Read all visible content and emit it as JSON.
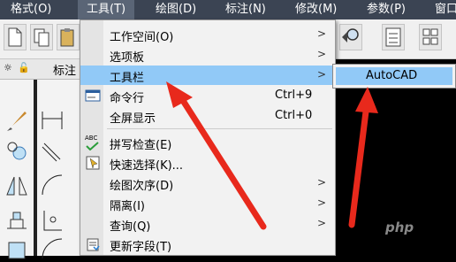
{
  "menubar": {
    "items": [
      "格式(O)",
      "工具(T)",
      "绘图(D)",
      "标注(N)",
      "修改(M)",
      "参数(P)",
      "窗口"
    ]
  },
  "row2": {
    "label": "标注"
  },
  "tools_menu": {
    "items": [
      {
        "label": "工作空间(O)",
        "shortcut": "",
        "submenu": true,
        "icon": ""
      },
      {
        "label": "选项板",
        "shortcut": "",
        "submenu": true,
        "icon": ""
      },
      {
        "label": "工具栏",
        "shortcut": "",
        "submenu": true,
        "icon": "",
        "highlighted": true
      },
      {
        "label": "命令行",
        "shortcut": "Ctrl+9",
        "submenu": false,
        "icon": "command-line-icon"
      },
      {
        "label": "全屏显示",
        "shortcut": "Ctrl+0",
        "submenu": false,
        "icon": ""
      },
      {
        "label": "拼写检查(E)",
        "shortcut": "",
        "submenu": false,
        "icon": "spell-check-icon"
      },
      {
        "label": "快速选择(K)...",
        "shortcut": "",
        "submenu": false,
        "icon": "quick-select-icon"
      },
      {
        "label": "绘图次序(D)",
        "shortcut": "",
        "submenu": true,
        "icon": ""
      },
      {
        "label": "隔离(I)",
        "shortcut": "",
        "submenu": true,
        "icon": ""
      },
      {
        "label": "查询(Q)",
        "shortcut": "",
        "submenu": true,
        "icon": ""
      },
      {
        "label": "更新字段(T)",
        "shortcut": "",
        "submenu": false,
        "icon": "update-fields-icon"
      }
    ],
    "spell_icon_text": "ABC"
  },
  "toolbar_submenu": {
    "item": "AutoCAD"
  },
  "watermark": "php",
  "colors": {
    "menubar": "#3b4453",
    "highlight": "#91c9f7",
    "annotation_arrow": "#e8291c"
  }
}
